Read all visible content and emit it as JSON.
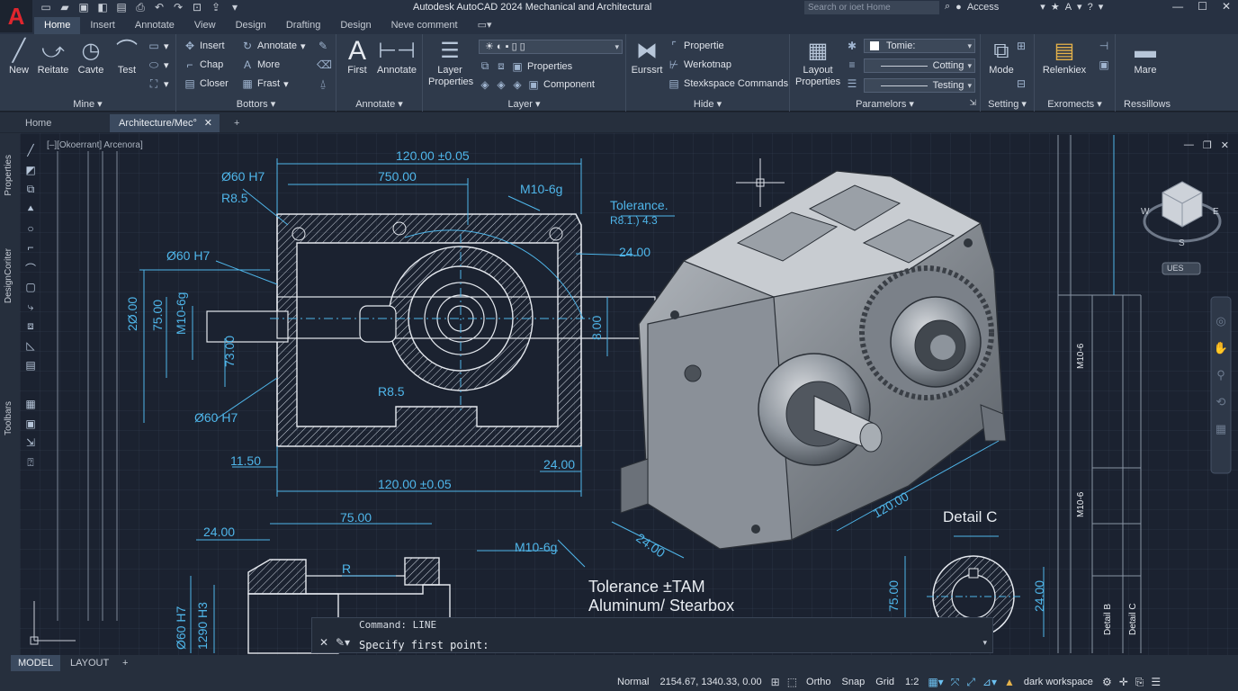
{
  "title_bar": {
    "app_letter": "A",
    "title": "Autodesk AutoCAD 2024  Mechanical and Architectural",
    "search_placeholder": "Search or ioet Home",
    "access_label": "Access",
    "qat_icons": [
      "new-icon",
      "open-icon",
      "save-icon",
      "saveas-icon",
      "plot-icon",
      "undo-icon",
      "redo-icon"
    ],
    "window_buttons": [
      "minimize-icon",
      "maximize-icon",
      "close-icon"
    ]
  },
  "ribbon_tabs": [
    "Home",
    "Insert",
    "Annotate",
    "View",
    "Design",
    "Drafting",
    "Design",
    "Neve comment"
  ],
  "ribbon": {
    "panel_mine": {
      "title": "Mine",
      "buttons": [
        "New",
        "Reitate",
        "Cavte",
        "Test"
      ]
    },
    "panel_bottors": {
      "title": "Bottors",
      "items": [
        "Insert",
        "Annotate",
        "Chap",
        "More",
        "Closer",
        "Frast"
      ]
    },
    "panel_annotate": {
      "title": "Annotate",
      "buttons": [
        "First",
        "Annotate"
      ]
    },
    "panel_layer": {
      "title": "Layer",
      "big": "Layer Properties",
      "items": [
        "Properties",
        "Component"
      ]
    },
    "panel_hide": {
      "title": "Hide",
      "big": "Eurssrt",
      "items": [
        "Propertie",
        "Werkotnap",
        "Stexkspace Commands"
      ]
    },
    "panel_paramelors": {
      "title": "Paramelors",
      "big": "Layout Properties",
      "combos": [
        "Tomie:",
        "Cotting",
        "Testing"
      ]
    },
    "panel_setting": {
      "title": "Setting",
      "big": "Mode"
    },
    "panel_exromects": {
      "title": "Exromects",
      "big": "Relenkiex"
    },
    "panel_ressillows": {
      "title": "Ressillows",
      "big": "Mare"
    }
  },
  "doc_tabs": {
    "home": "Home",
    "active": "Architecture/Mec°",
    "add": "+"
  },
  "viewport": {
    "label": "[–][Okoerrant] Arcenora]",
    "left_labels": [
      "Properties",
      "DesignCoriter",
      "Toolbars"
    ],
    "viewcube": {
      "w": "W",
      "e": "E",
      "s": "S",
      "ucs": "UES"
    }
  },
  "drawing": {
    "dims_top": [
      "120.00 ±0.05",
      "750.00",
      "M10-6g",
      "Ø60 H7",
      "R8.5",
      "Ø60 H7",
      "Tolerance.",
      "R8.1.) 4.3",
      "24.00"
    ],
    "dims_left": [
      "2Ø.00",
      "75.00",
      "M10-6g",
      "73.00",
      "Ø60 H7",
      "R8.5",
      "11.50",
      "24.00",
      "8.00",
      "120.00 ±0.05"
    ],
    "dims_lower": [
      "75.00",
      "24.00",
      "M10-6g",
      "R",
      "Ø60 H7",
      "1290 H3"
    ],
    "iso_dims": [
      "24.00",
      "120.00"
    ],
    "detail_label": "Detail C",
    "detail_dims": [
      "75.00",
      "24.00"
    ],
    "note_line1": "Tolerance ±TAM",
    "note_line2": "Aluminum/ Stearbox",
    "right_labels": [
      "M10-6",
      "M10-6",
      "Detail B",
      "Detail C"
    ]
  },
  "command_line": {
    "history": "Command: LINE",
    "prompt": "Specify first point:"
  },
  "layout_tabs": [
    "MODEL",
    "LAYOUT",
    "+"
  ],
  "status_bar": {
    "mode": "Normal",
    "coords": "2154.67, 1340.33, 0.00",
    "ortho": "Ortho",
    "snap": "Snap",
    "grid": "Grid",
    "scale": "1:2",
    "workspace": "dark workspace"
  }
}
